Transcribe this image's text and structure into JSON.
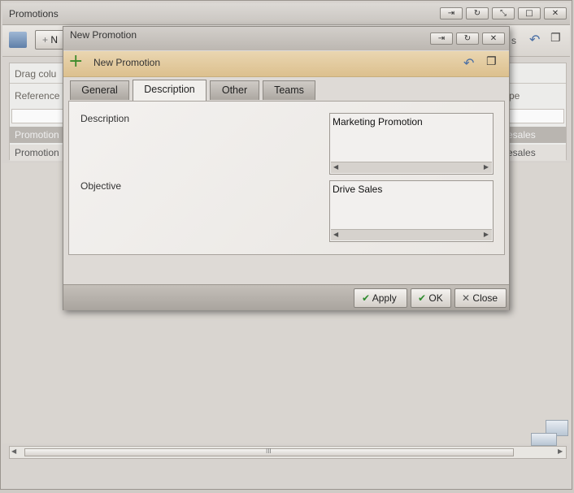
{
  "main_window": {
    "title": "Promotions",
    "toolbar_new_label": "N",
    "toolbar_right_partial": "s",
    "grid": {
      "drag_hint": "Drag colu",
      "col_reference": "Reference",
      "col_right_partial": "pe",
      "rows": [
        {
          "left": "Promotion",
          "right": "esales"
        },
        {
          "left": "Promotion",
          "right": "esales"
        }
      ]
    },
    "hscroll_grip": "III"
  },
  "dialog": {
    "title": "New Promotion",
    "header_title": "New Promotion",
    "tabs": [
      {
        "label": "General"
      },
      {
        "label": "Description"
      },
      {
        "label": "Other"
      },
      {
        "label": "Teams"
      }
    ],
    "active_tab": "Description",
    "fields": {
      "description_label": "Description",
      "description_value": "Marketing Promotion",
      "objective_label": "Objective",
      "objective_value": "Drive Sales"
    },
    "buttons": {
      "apply": "Apply",
      "ok": "OK",
      "close": "Close"
    }
  },
  "icons": {
    "plus": "+",
    "pin": "⇥",
    "refresh": "↻",
    "close": "✕",
    "arrow_left": "◀",
    "arrow_right": "▶",
    "undo": "↶",
    "restore": "❐"
  },
  "colors": {
    "header_accent": "#dcc08e",
    "check_green": "#2e8b2e"
  }
}
